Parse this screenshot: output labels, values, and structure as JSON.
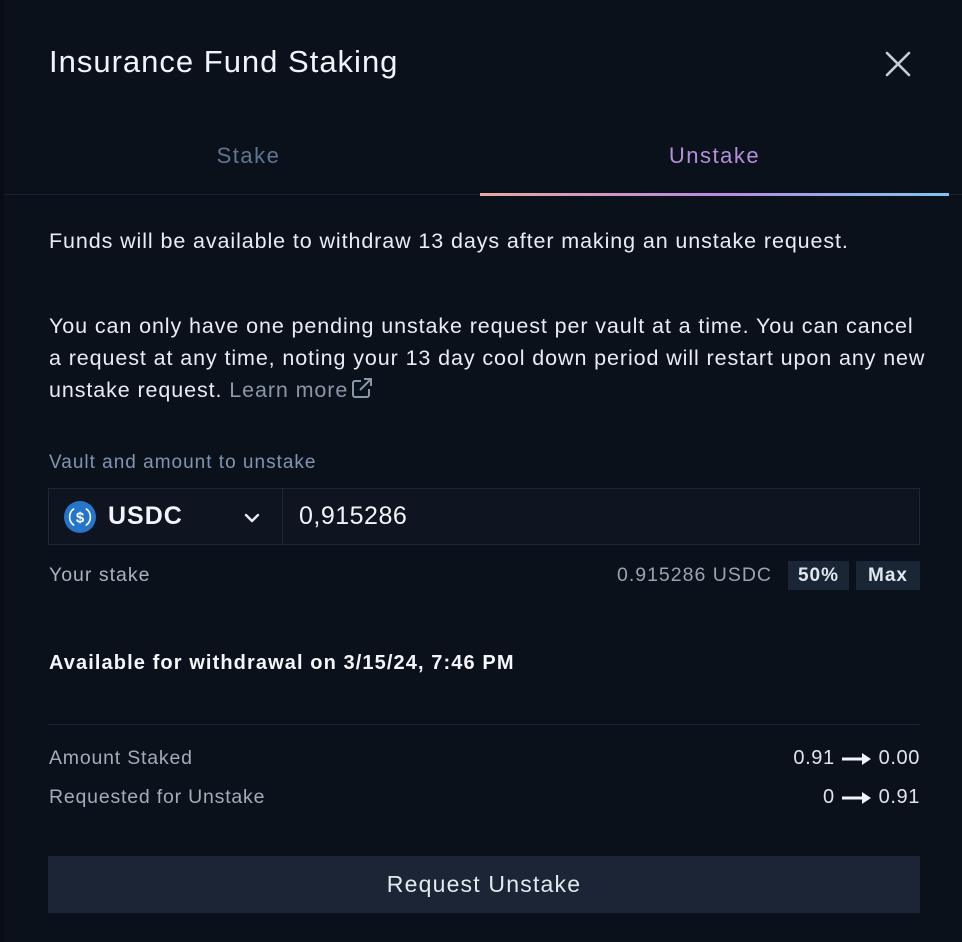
{
  "modal": {
    "title": "Insurance Fund Staking"
  },
  "tabs": [
    {
      "label": "Stake",
      "active": false
    },
    {
      "label": "Unstake",
      "active": true
    }
  ],
  "info": {
    "paragraph1": "Funds will be available to withdraw 13 days after making an unstake request.",
    "paragraph2": "You can only have one pending unstake request per vault at a time. You can cancel a request at any time, noting your 13 day cool down period will restart upon any new unstake request.",
    "learn_more": "Learn more"
  },
  "form": {
    "label": "Vault and amount to unstake",
    "vault": "USDC",
    "vault_icon": "usdc-coin-icon",
    "amount": "0,915286"
  },
  "stake": {
    "label": "Your stake",
    "value": "0.915286 USDC",
    "half_label": "50%",
    "max_label": "Max"
  },
  "availability": "Available for withdrawal on 3/15/24, 7:46 PM",
  "summary": [
    {
      "label": "Amount Staked",
      "from": "0.91",
      "to": "0.00"
    },
    {
      "label": "Requested for Unstake",
      "from": "0",
      "to": "0.91"
    }
  ],
  "action": {
    "label": "Request Unstake"
  },
  "colors": {
    "background": "#0b111b",
    "accent_gradient": [
      "#e9a8a0",
      "#b88ae0",
      "#7fc4ec"
    ],
    "usdc_blue": "#2775ca",
    "button": "#1b2535"
  }
}
